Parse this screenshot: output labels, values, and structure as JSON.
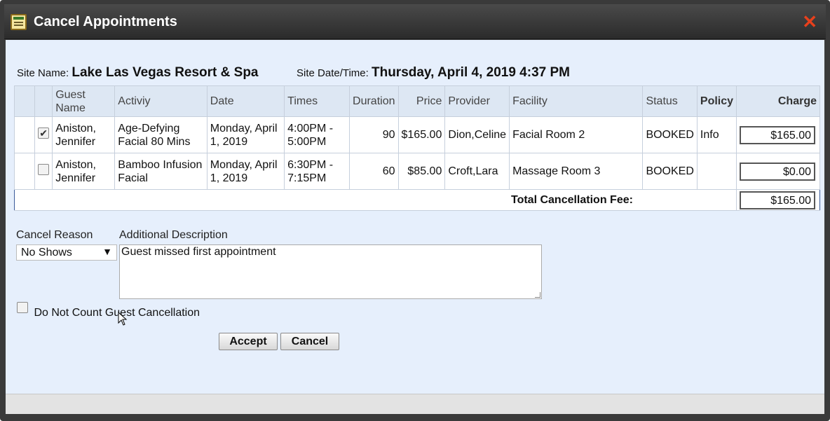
{
  "dialog": {
    "title": "Cancel Appointments",
    "close": "✕"
  },
  "site": {
    "name_label": "Site Name:",
    "name": "Lake Las Vegas Resort & Spa",
    "datetime_label": "Site Date/Time:",
    "datetime": "Thursday, April 4, 2019 4:37 PM"
  },
  "table": {
    "headers": [
      "Guest Name",
      "Activiy",
      "Date",
      "Times",
      "Duration",
      "Price",
      "Provider",
      "Facility",
      "Status",
      "Policy",
      "Charge"
    ],
    "rows": [
      {
        "checked": true,
        "guest": "Aniston, Jennifer",
        "activity": "Age-Defying Facial 80 Mins",
        "date": "Monday, April 1, 2019",
        "times": "4:00PM - 5:00PM",
        "duration": "90",
        "price": "$165.00",
        "provider": "Dion,Celine",
        "facility": "Facial Room 2",
        "status": "BOOKED",
        "policy": "Info",
        "charge": "$165.00"
      },
      {
        "checked": false,
        "guest": "Aniston, Jennifer",
        "activity": "Bamboo Infusion Facial",
        "date": "Monday, April 1, 2019",
        "times": "6:30PM - 7:15PM",
        "duration": "60",
        "price": "$85.00",
        "provider": "Croft,Lara",
        "facility": "Massage Room 3",
        "status": "BOOKED",
        "policy": "",
        "charge": "$0.00"
      }
    ],
    "total_label": "Total Cancellation Fee:",
    "total": "$165.00"
  },
  "form": {
    "cancel_reason_label": "Cancel Reason",
    "cancel_reason_value": "No Shows",
    "description_label": "Additional Description",
    "description_value": "Guest missed first appointment",
    "no_count_label": "Do Not Count Guest Cancellation",
    "no_count_checked": false
  },
  "buttons": {
    "accept": "Accept",
    "cancel": "Cancel"
  }
}
